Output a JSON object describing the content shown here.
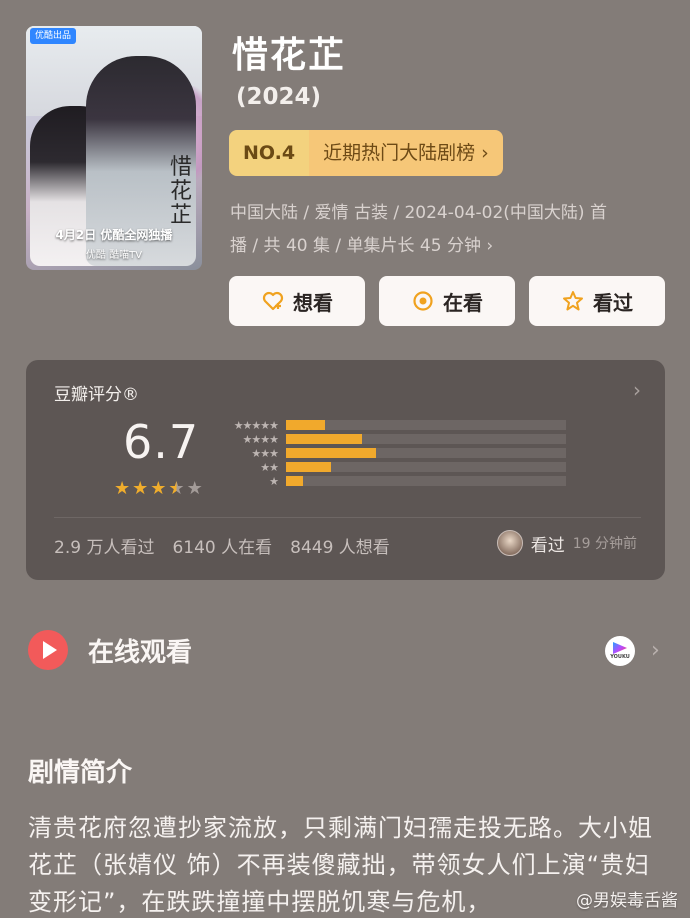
{
  "poster": {
    "badge": "优酷出品",
    "title": "惜花芷",
    "date_line": "4月2日 优酷全网独播",
    "platforms": "优酷  酷喵TV"
  },
  "header": {
    "title": "惜花芷",
    "year": "(2024)",
    "rank_no": "NO.4",
    "rank_label": "近期热门大陆剧榜",
    "meta_line1": "中国大陆 / 爱情 古装 / 2024-04-02(中国大陆) 首",
    "meta_line2": "播 / 共 40 集 / 单集片长 45 分钟 ›"
  },
  "actions": {
    "want": "想看",
    "watching": "在看",
    "watched": "看过"
  },
  "rating": {
    "heading": "豆瓣评分®",
    "score": "6.7",
    "star_count": 3.5,
    "distribution": [
      {
        "stars": "★★★★★",
        "fraction": 0.14
      },
      {
        "stars": "★★★★",
        "fraction": 0.27
      },
      {
        "stars": "★★★",
        "fraction": 0.32
      },
      {
        "stars": "★★",
        "fraction": 0.16
      },
      {
        "stars": "★",
        "fraction": 0.06
      }
    ],
    "stats": [
      "2.9 万人看过",
      "6140 人在看",
      "8449 人想看"
    ],
    "friend_status": "看过",
    "friend_time": "19 分钟前"
  },
  "online": {
    "label": "在线观看",
    "provider": "YOUKU"
  },
  "synopsis": {
    "title": "剧情简介",
    "text": "清贵花府忽遭抄家流放，只剩满门妇孺走投无路。大小姐花芷（张婧仪 饰）不再装傻藏拙，带领女人们上演“贵妇变形记”，在跌跌撞撞中摆脱饥寒与危机，"
  },
  "watermark": "@男娱毒舌酱",
  "colors": {
    "background": "#837c78",
    "card": "#5d5654",
    "star": "#f0ad2c",
    "rank": "#f6c778",
    "play": "#f25a5a"
  }
}
